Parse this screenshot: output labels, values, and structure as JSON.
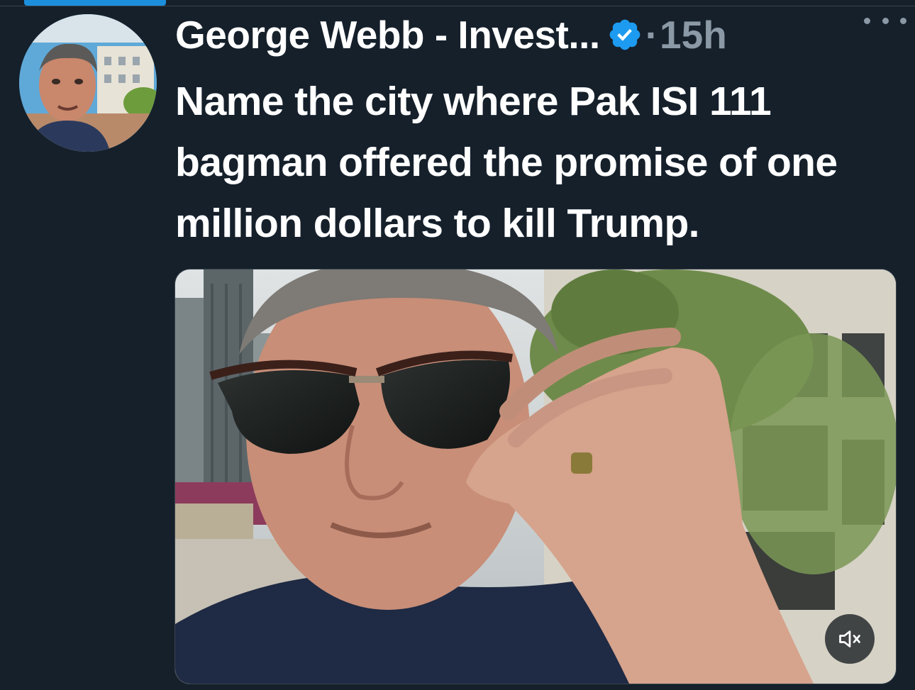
{
  "tweet": {
    "author": {
      "display_name": "George Webb - Invest...",
      "verified": true,
      "avatar_icon": "profile-photo"
    },
    "separator": "·",
    "timestamp": "15h",
    "more_icon": "more-options-icon",
    "text": "Name the city where Pak ISI 111 bagman offered the promise of one million dollars to kill Trump.",
    "media": {
      "type": "video",
      "mute_icon": "volume-muted-icon"
    }
  },
  "colors": {
    "background": "#15202b",
    "text": "#ffffff",
    "secondary_text": "#8b98a5",
    "verified_badge": "#1d9bf0",
    "border": "#38444d"
  }
}
